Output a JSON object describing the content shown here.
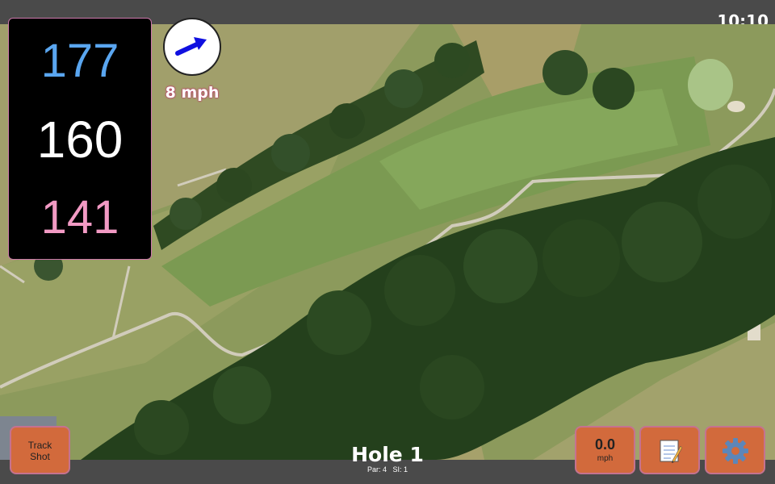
{
  "status": {
    "time": "10:10"
  },
  "distances": {
    "back": {
      "value": "177",
      "color": "#5aa6f0"
    },
    "middle": {
      "value": "160",
      "color": "#ffffff"
    },
    "front": {
      "value": "141",
      "color": "#f29ac4"
    }
  },
  "wind": {
    "speed_label": "8 mph",
    "arrow_color": "#1010e0"
  },
  "hole": {
    "title": "Hole 1",
    "par_label": "Par: 4",
    "si_label": "SI: 1"
  },
  "buttons": {
    "track_shot": {
      "line1": "Track",
      "line2": "Shot"
    },
    "speed": {
      "value": "0.0",
      "unit": "mph"
    },
    "notes_icon": "notepad-icon",
    "settings_icon": "gear-icon"
  },
  "theme": {
    "button_color": "#d26a3c",
    "button_border": "#c57290",
    "bar_color": "#4a4a4a"
  }
}
